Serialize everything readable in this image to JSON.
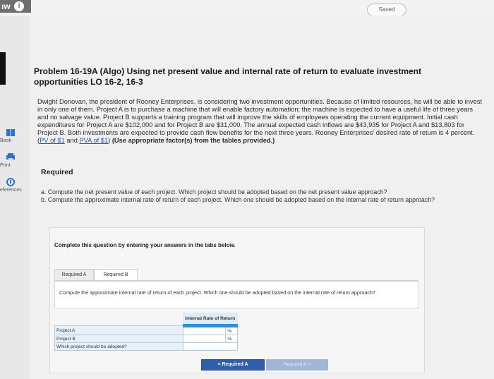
{
  "topbar": {
    "hw_label": "ıw",
    "info_icon": "info-icon",
    "saved": "Saved"
  },
  "left_rail": {
    "book_label": "Book",
    "print_label": "Print",
    "references_label": "eferences"
  },
  "problem": {
    "title": "Problem 16-19A (Algo) Using net present value and internal rate of return to evaluate investment opportunities LO 16-2, 16-3",
    "body_before_links": "Dwight Donovan, the president of Rooney Enterprises, is considering two investment opportunities. Because of limited resources, he will be able to invest in only one of them. Project A is to purchase a machine that will enable factory automation; the machine is expected to have a useful life of three years and no salvage value. Project B supports a training program that will improve the skills of employees operating the current equipment. Initial cash expenditures for Project A are $102,000 and for Project B are $31,000. The annual expected cash inflows are $43,935 for Project A and $13,803 for Project B. Both investments are expected to provide cash flow benefits for the next three years. Rooney Enterprises' desired rate of return is 4 percent.",
    "link1": "PV of $1",
    "mid_text": " and ",
    "link2": "PVA of $1",
    "after_links": ")",
    "instructions": " (Use appropriate factor(s) from the tables provided.)"
  },
  "required": {
    "heading": "Required",
    "items": [
      "a. Compute the net present value of each project. Which project should be adopted based on the net present value approach?",
      "b. Compute the approximate internal rate of return of each project. Which one should be adopted based on the internal rate of return approach?"
    ]
  },
  "panel": {
    "instruction": "Complete this question by entering your answers in the tabs below.",
    "tabs": [
      "Required A",
      "Required B"
    ],
    "question": "Compute the approximate internal rate of return of each project. Which one should be adopted based on the internal rate of return approach?",
    "table": {
      "column_header": "Internal Rate of Return",
      "rows": [
        {
          "label": "Project A",
          "value": "",
          "unit": "%"
        },
        {
          "label": "Project B",
          "value": "",
          "unit": "%"
        },
        {
          "label": "Which project should be adopted?",
          "value": "",
          "unit": ""
        }
      ]
    },
    "nav": {
      "prev": "< Required A",
      "next": "Required B >"
    }
  }
}
